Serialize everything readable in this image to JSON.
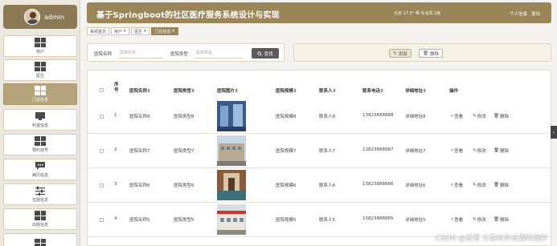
{
  "user": {
    "name": "admin"
  },
  "sidebar": {
    "items": [
      {
        "label": "用户"
      },
      {
        "label": "医生"
      },
      {
        "label": "门诊信息"
      },
      {
        "label": "科室信息"
      },
      {
        "label": "预约挂号"
      },
      {
        "label": "病历信息"
      },
      {
        "label": "住院信息"
      },
      {
        "label": "出院信息"
      }
    ]
  },
  "header": {
    "title": "基于Springboot的社区医疗服务系统设计与实现",
    "weather": "北京  17.5°  晴  东北风  2级",
    "profile": "个人信息",
    "logout": "退出"
  },
  "tags": [
    {
      "label": "系统首页",
      "closable": false
    },
    {
      "label": "用户",
      "closable": true
    },
    {
      "label": "医生",
      "closable": true
    },
    {
      "label": "门诊信息",
      "closable": true
    }
  ],
  "search": {
    "name_label": "医院名称",
    "name_placeholder": "医院名称",
    "type_label": "医院类型",
    "type_placeholder": "医院类型",
    "button": "查找"
  },
  "actions": {
    "add": "添加",
    "delete": "删除"
  },
  "table": {
    "headers": {
      "index": "序号",
      "name": "医院名称",
      "type": "医院类型",
      "image": "医院图片",
      "scale": "医院规模",
      "contact": "联系人",
      "phone": "联系电话",
      "address": "详细地址",
      "ops": "操作"
    },
    "sort_mark": "⇕",
    "op_labels": {
      "view": "查看",
      "edit": "修改",
      "delete": "删除"
    },
    "rows": [
      {
        "index": "1",
        "name": "医院名称8",
        "type": "医院类型8",
        "scale": "医院规模8",
        "contact": "联系人8",
        "phone": "13823888888",
        "address": "详细地址8"
      },
      {
        "index": "2",
        "name": "医院名称7",
        "type": "医院类型7",
        "scale": "医院规模7",
        "contact": "联系人7",
        "phone": "13823888887",
        "address": "详细地址7"
      },
      {
        "index": "3",
        "name": "医院名称6",
        "type": "医院类型6",
        "scale": "医院规模6",
        "contact": "联系人6",
        "phone": "13823888886",
        "address": "详细地址6"
      },
      {
        "index": "4",
        "name": "医院名称5",
        "type": "医院类型5",
        "scale": "医院规模5",
        "contact": "联系人5",
        "phone": "13823888885",
        "address": "详细地址5"
      }
    ]
  },
  "watermark": "CSDN @青青   计算机毕设源码程序",
  "colors": {
    "accent": "#9a8558",
    "active_menu": "#b5a47b",
    "search_button": "#5a5a58"
  }
}
